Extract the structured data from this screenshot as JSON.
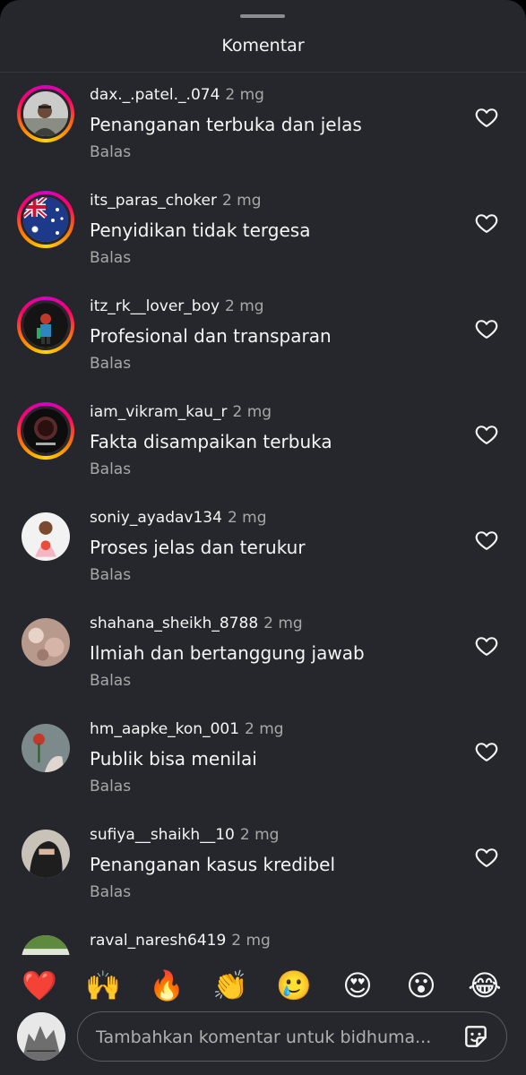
{
  "header": {
    "title": "Komentar"
  },
  "comments": [
    {
      "username": "dax._.patel._.074",
      "time": "2 mg",
      "text": "Penanganan terbuka dan jelas",
      "reply_label": "Balas"
    },
    {
      "username": "its_paras_choker",
      "time": "2 mg",
      "text": "Penyidikan tidak tergesa",
      "reply_label": "Balas"
    },
    {
      "username": "itz_rk__lover_boy",
      "time": "2 mg",
      "text": "Profesional dan transparan",
      "reply_label": "Balas"
    },
    {
      "username": "iam_vikram_kau_r",
      "time": "2 mg",
      "text": "Fakta disampaikan terbuka",
      "reply_label": "Balas"
    },
    {
      "username": "soniy_ayadav134",
      "time": "2 mg",
      "text": "Proses jelas dan terukur",
      "reply_label": "Balas"
    },
    {
      "username": "shahana_sheikh_8788",
      "time": "2 mg",
      "text": "Ilmiah dan bertanggung jawab",
      "reply_label": "Balas"
    },
    {
      "username": "hm_aapke_kon_001",
      "time": "2 mg",
      "text": "Publik bisa menilai",
      "reply_label": "Balas"
    },
    {
      "username": "sufiya__shaikh__10",
      "time": "2 mg",
      "text": "Penanganan kasus kredibel",
      "reply_label": "Balas"
    },
    {
      "username": "raval_naresh6419",
      "time": "2 mg",
      "text": "",
      "reply_label": ""
    }
  ],
  "emoji_bar": [
    "❤️",
    "🙌",
    "🔥",
    "👏",
    "🥲",
    "😍",
    "😮",
    "😂"
  ],
  "composer": {
    "placeholder": "Tambahkan komentar untuk bidhuma..."
  },
  "colors": {
    "background": "#25272c",
    "ring_start": "#d300c5",
    "ring_end": "#ffd600",
    "secondary_text": "#a8a8a8"
  }
}
